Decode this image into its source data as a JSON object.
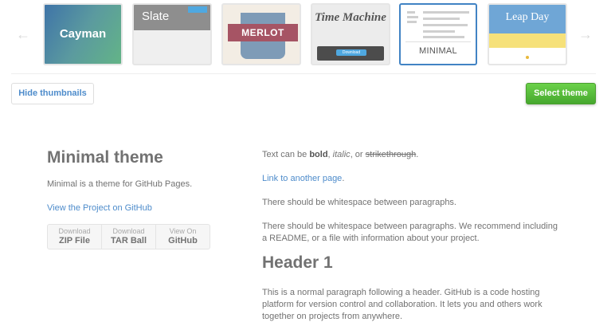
{
  "chooser": {
    "themes": [
      {
        "label": "Cayman"
      },
      {
        "label": "Slate"
      },
      {
        "label": "MERLOT"
      },
      {
        "label": "Time Machine",
        "button_label": "Download"
      },
      {
        "label": "MINIMAL",
        "selected": true
      },
      {
        "label": "Leap Day"
      }
    ],
    "hide_button": "Hide thumbnails",
    "select_button": "Select theme",
    "colors": {
      "selected_border": "#4183c4",
      "select_button": "#5cbf3c"
    }
  },
  "sidebar": {
    "title": "Minimal theme",
    "description": "Minimal is a theme for GitHub Pages.",
    "project_link": "View the Project on GitHub",
    "downloads": [
      {
        "small": "Download",
        "big": "ZIP File"
      },
      {
        "small": "Download",
        "big": "TAR Ball"
      },
      {
        "small": "View On",
        "big": "GitHub"
      }
    ]
  },
  "content": {
    "text_line": {
      "prefix": "Text can be ",
      "bold": "bold",
      "sep1": ", ",
      "italic": "italic",
      "sep2": ", or ",
      "strike": "strikethrough",
      "suffix": "."
    },
    "link_text": "Link to another page",
    "link_suffix": ".",
    "para1": "There should be whitespace between paragraphs.",
    "para2": "There should be whitespace between paragraphs. We recommend including a README, or a file with information about your project.",
    "header1": "Header 1",
    "para3": "This is a normal paragraph following a header. GitHub is a code hosting platform for version control and collaboration. It lets you and others work together on projects from anywhere."
  }
}
